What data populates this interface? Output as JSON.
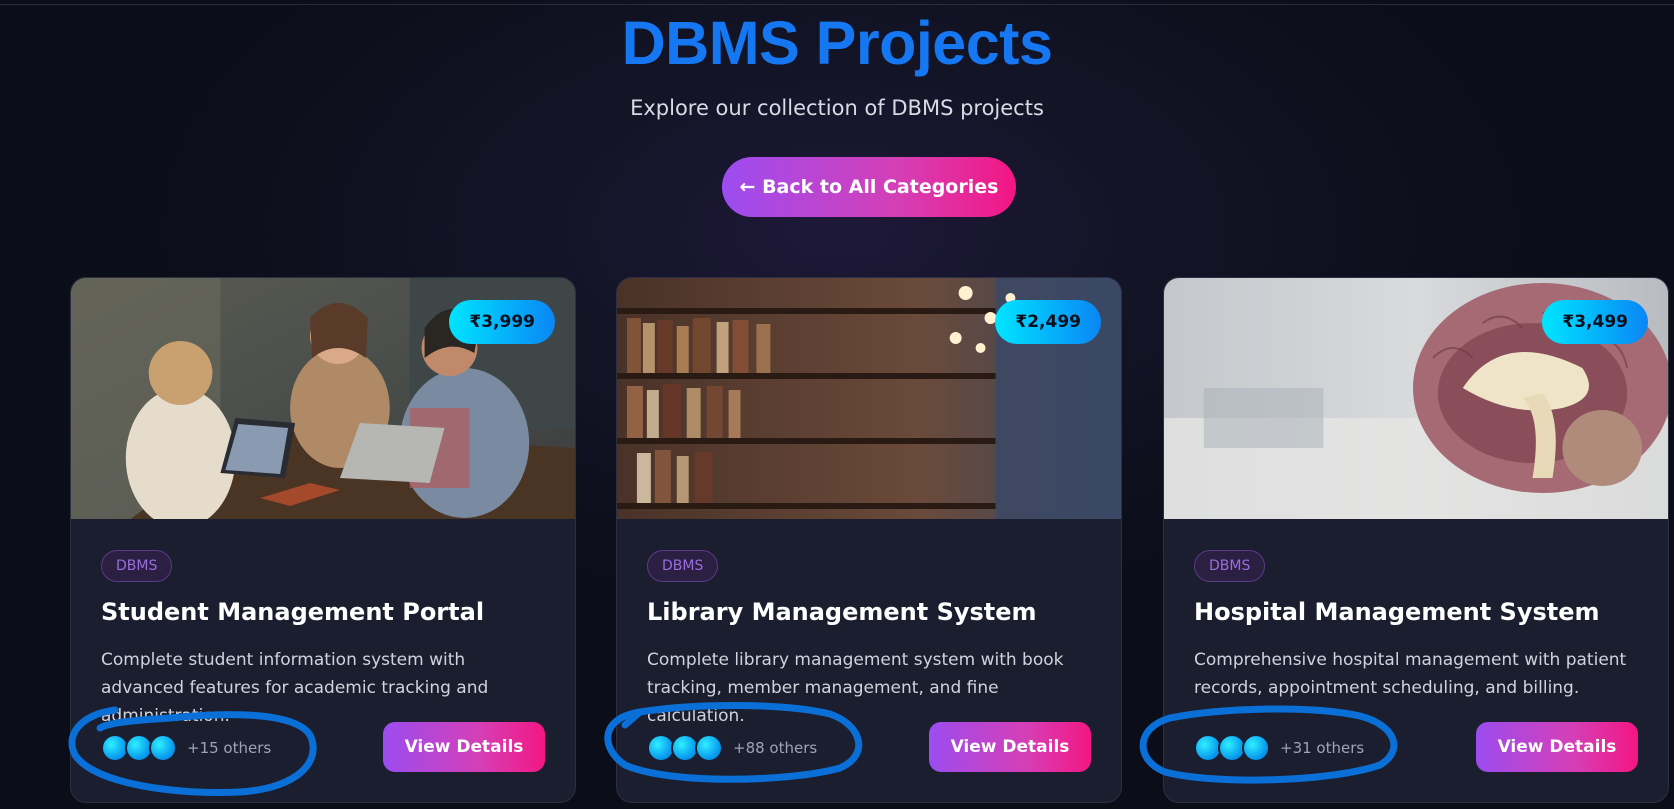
{
  "header": {
    "title": "DBMS Projects",
    "subtitle": "Explore our collection of DBMS projects",
    "back_label": "← Back to All Categories"
  },
  "projects": [
    {
      "price": "₹3,999",
      "tag": "DBMS",
      "title": "Student Management Portal",
      "description": "Complete student information system with advanced features for academic tracking and administration.",
      "others": "+15 others",
      "button": "View Details",
      "image": "students-with-laptops-photo"
    },
    {
      "price": "₹2,499",
      "tag": "DBMS",
      "title": "Library Management System",
      "description": "Complete library management system with book tracking, member management, and fine calculation.",
      "others": "+88 others",
      "button": "View Details",
      "image": "library-bookshelves-photo"
    },
    {
      "price": "₹3,499",
      "tag": "DBMS",
      "title": "Hospital Management System",
      "description": "Comprehensive hospital management with patient records, appointment scheduling, and billing.",
      "others": "+31 others",
      "button": "View Details",
      "image": "brain-model-photo"
    }
  ],
  "colors": {
    "title": "#1677f2",
    "button_gradient_start": "#9c4cf0",
    "button_gradient_end": "#f31683",
    "price_gradient_start": "#00e5ff",
    "price_gradient_end": "#0a86f5",
    "annotation_marker": "#0a6fd6"
  }
}
